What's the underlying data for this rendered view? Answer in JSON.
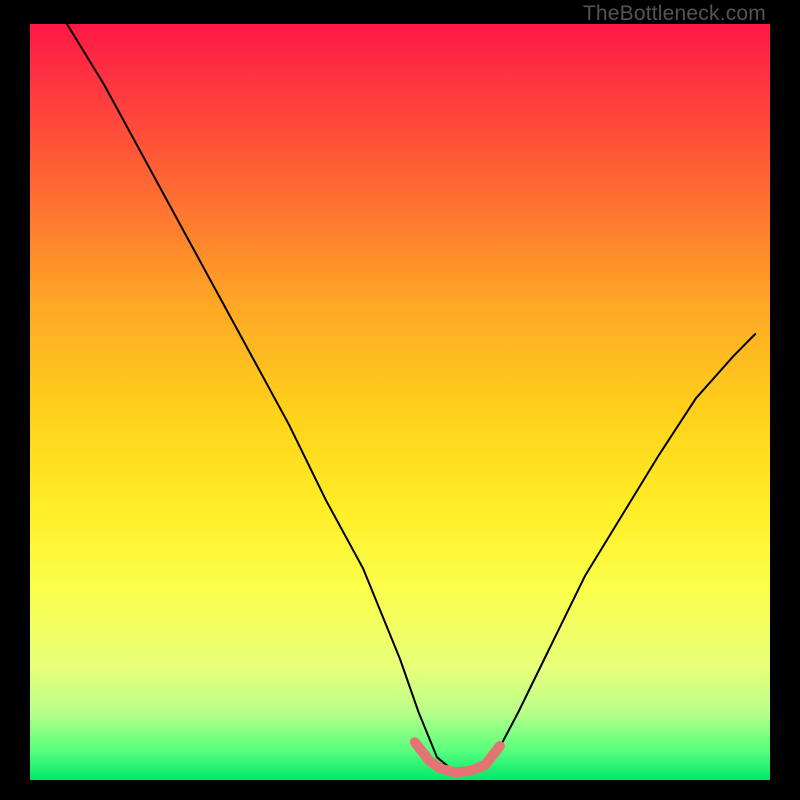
{
  "watermark": "TheBottleneck.com",
  "colors": {
    "chart_stops": [
      "#FF1846",
      "#FF3D3F",
      "#FF6A32",
      "#FFA726",
      "#FFD21A",
      "#FFEE26",
      "#FBFF4D",
      "#E8FF7A",
      "#B9FF8A",
      "#5BFF7E",
      "#00E86A"
    ],
    "curve": "#000000",
    "marker": "#E57373",
    "frame": "#000000"
  },
  "chart_data": {
    "type": "line",
    "title": "",
    "xlabel": "",
    "ylabel": "",
    "xlim": [
      0,
      1
    ],
    "ylim": [
      0,
      1
    ],
    "note": "Axes are unlabeled in the source image; values are normalized 0–1. The curve is a V-shaped bottleneck profile descending from top-left to a minimum near x≈0.57 then rising toward the right.",
    "series": [
      {
        "name": "bottleneck-curve",
        "x": [
          0.05,
          0.1,
          0.15,
          0.2,
          0.25,
          0.3,
          0.35,
          0.4,
          0.45,
          0.5,
          0.525,
          0.55,
          0.575,
          0.6,
          0.625,
          0.66,
          0.7,
          0.75,
          0.8,
          0.85,
          0.9,
          0.95,
          0.98
        ],
        "values": [
          1.0,
          0.92,
          0.83,
          0.74,
          0.65,
          0.56,
          0.47,
          0.37,
          0.28,
          0.16,
          0.09,
          0.03,
          0.01,
          0.01,
          0.025,
          0.09,
          0.17,
          0.27,
          0.35,
          0.43,
          0.505,
          0.56,
          0.59
        ]
      },
      {
        "name": "min-highlight",
        "x": [
          0.52,
          0.54,
          0.555,
          0.575,
          0.595,
          0.615,
          0.635
        ],
        "values": [
          0.05,
          0.025,
          0.015,
          0.01,
          0.012,
          0.02,
          0.045
        ]
      }
    ]
  }
}
